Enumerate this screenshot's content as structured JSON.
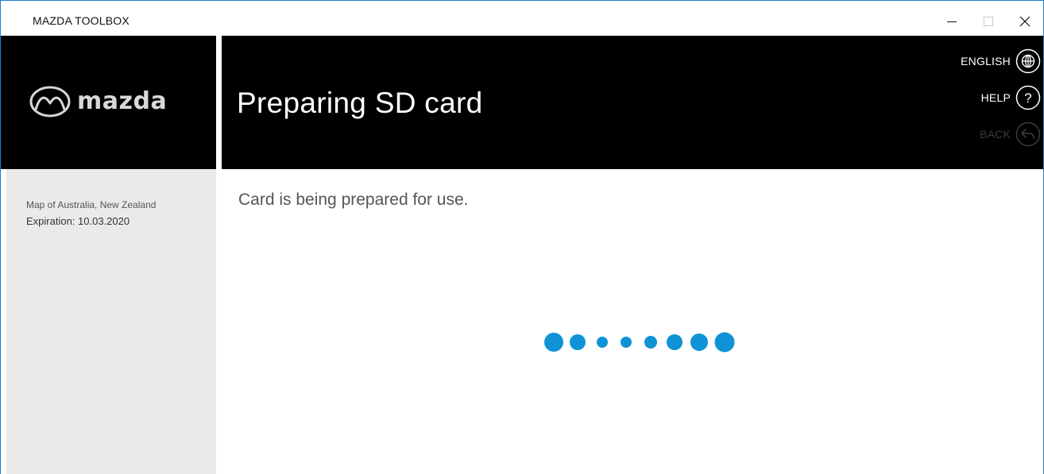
{
  "window": {
    "title": "MAZDA TOOLBOX",
    "controls": {
      "minimize_icon": "minimize-icon",
      "maximize_icon": "maximize-icon",
      "close_icon": "close-icon"
    }
  },
  "brand": {
    "logo_text": "mazda",
    "logo_icon": "mazda-emblem-icon"
  },
  "header": {
    "title": "Preparing SD card",
    "actions": [
      {
        "label": "ENGLISH",
        "icon": "globe-icon",
        "enabled": true
      },
      {
        "label": "HELP",
        "icon": "question-icon",
        "enabled": true
      },
      {
        "label": "BACK",
        "icon": "back-arrow-icon",
        "enabled": false
      }
    ]
  },
  "sidebar": {
    "map_name": "Map of Australia, New Zealand",
    "expiration": "Expiration: 10.03.2020"
  },
  "main": {
    "status": "Card is being prepared for use.",
    "progress_indicator": {
      "type": "dots",
      "count": 8,
      "color": "#0f93d6"
    }
  },
  "colors": {
    "accent": "#0f93d6",
    "header_bg": "#000000",
    "sidebar_bg": "#eaeaea",
    "window_border": "#1b7fd0"
  }
}
